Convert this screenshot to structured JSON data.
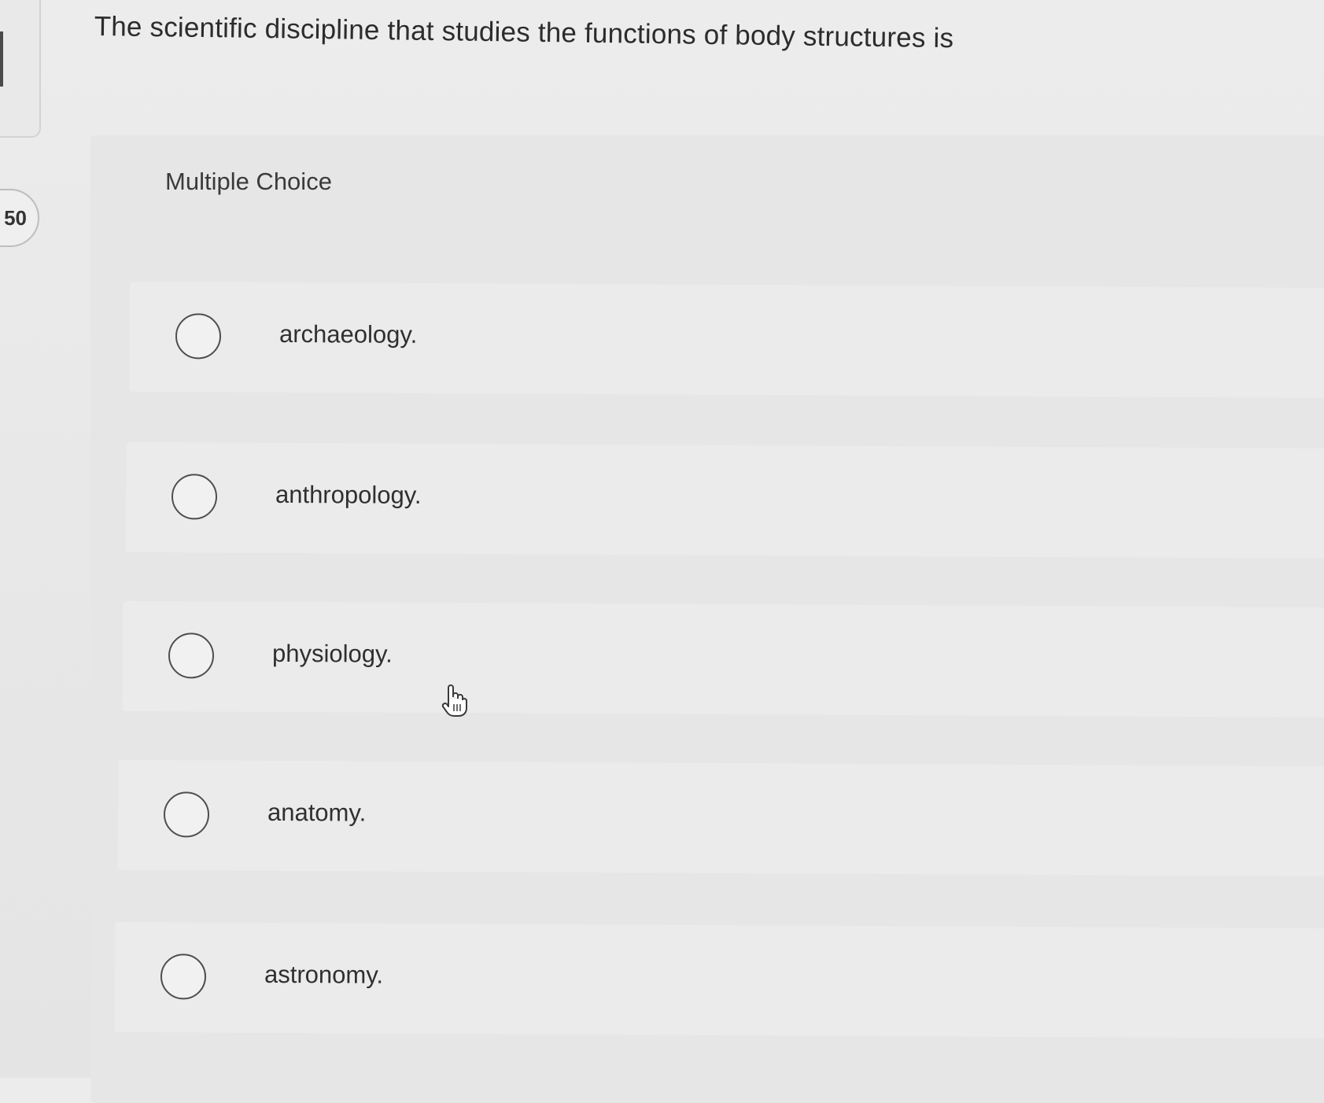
{
  "question": {
    "counter": "50",
    "text": "The scientific discipline that studies the functions of body structures is"
  },
  "choice_type": "Multiple Choice",
  "options": [
    {
      "label": "archaeology.",
      "selected": false
    },
    {
      "label": "anthropology.",
      "selected": false
    },
    {
      "label": "physiology.",
      "selected": false
    },
    {
      "label": "anatomy.",
      "selected": false
    },
    {
      "label": "astronomy.",
      "selected": false
    }
  ],
  "icons": {
    "radio": "radio-button-icon",
    "cursor": "hand-pointer-icon"
  }
}
